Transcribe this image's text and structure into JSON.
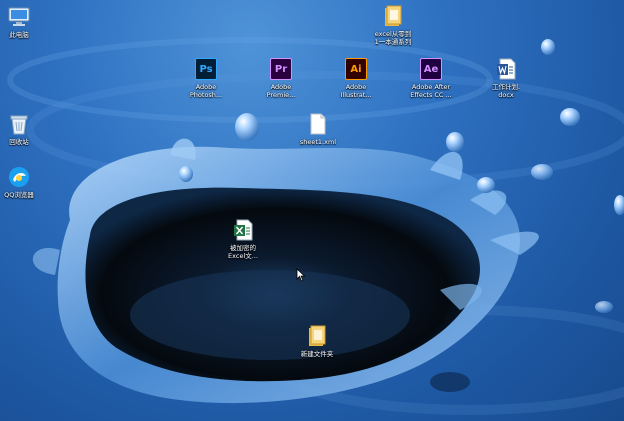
{
  "desktop": {
    "icons": [
      {
        "id": "this-pc",
        "label": "此电脑",
        "icon": "monitor-icon"
      },
      {
        "id": "recycle-bin",
        "label": "回收站",
        "icon": "recycle-bin-icon"
      },
      {
        "id": "qq-browser",
        "label": "QQ浏览器",
        "icon": "qq-browser-icon"
      },
      {
        "id": "excel-folder",
        "label": "excel从零到\n1一本通系列",
        "icon": "folder-icon"
      },
      {
        "id": "photoshop",
        "label": "Adobe\nPhotosh...",
        "icon": "photoshop-icon",
        "short": "Ps",
        "color": "#31a8ff",
        "bg": "#001e36"
      },
      {
        "id": "premiere",
        "label": "Adobe\nPremie...",
        "icon": "premiere-icon",
        "short": "Pr",
        "color": "#d291ff",
        "bg": "#2a003f"
      },
      {
        "id": "illustrator",
        "label": "Adobe\nIllustrat...",
        "icon": "illustrator-icon",
        "short": "Ai",
        "color": "#ff9a00",
        "bg": "#330000"
      },
      {
        "id": "after-effects",
        "label": "Adobe After\nEffects CC ...",
        "icon": "after-effects-icon",
        "short": "Ae",
        "color": "#d291ff",
        "bg": "#1f0040"
      },
      {
        "id": "work-plan",
        "label": "工作计划.\ndocx",
        "icon": "word-document-icon"
      },
      {
        "id": "sheet-xml",
        "label": "sheet1.xml",
        "icon": "blank-file-icon"
      },
      {
        "id": "encrypted-excel",
        "label": "被加密的\nExcel文...",
        "icon": "excel-file-icon"
      },
      {
        "id": "new-folder",
        "label": "新建文件夹",
        "icon": "folder-icon"
      }
    ]
  },
  "colors": {
    "wallpaper_blue": "#2f72c2",
    "wallpaper_dark": "#06101e",
    "adobe_ps": "#31a8ff",
    "word_blue": "#2b579a",
    "excel_green": "#217346"
  }
}
